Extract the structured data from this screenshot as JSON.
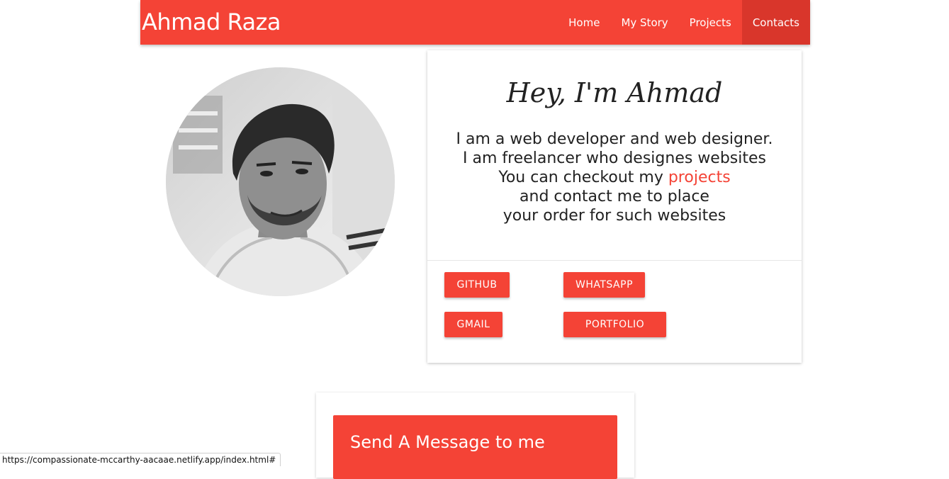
{
  "brand": "Ahmad Raza",
  "nav": {
    "items": [
      {
        "label": "Home"
      },
      {
        "label": "My Story"
      },
      {
        "label": "Projects"
      },
      {
        "label": "Contacts",
        "active": true
      }
    ]
  },
  "profile": {
    "avatar_icon": "profile-photo",
    "title": "Hey,  I'm Ahmad",
    "bio": {
      "line1": "I am a web developer and web designer.",
      "line2": "I am freelancer who designes websites",
      "line3_prefix": "You can checkout my ",
      "line3_link": "projects",
      "line4": "and contact me to place",
      "line5": "your order for such websites"
    }
  },
  "buttons": {
    "github": "GITHUB",
    "whatsapp": "WHATSAPP",
    "gmail": "GMAIL",
    "portfolio": "PORTFOLIO"
  },
  "message": {
    "title": "Send A Message to me"
  },
  "status_url": "https://compassionate-mccarthy-aacaae.netlify.app/index.html#",
  "colors": {
    "accent": "#f44336",
    "accent_dark": "#d9362b",
    "link": "#f44336"
  }
}
